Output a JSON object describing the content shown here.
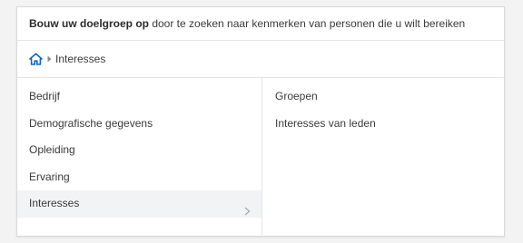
{
  "header": {
    "bold_text": "Bouw uw doelgroep op",
    "rest_text": " door te zoeken naar kenmerken van personen die u wilt bereiken"
  },
  "breadcrumb": {
    "home_icon": "home-icon",
    "separator_icon": "caret-right-icon",
    "current": "Interesses"
  },
  "left_menu": {
    "items": [
      {
        "label": "Bedrijf"
      },
      {
        "label": "Demografische gegevens"
      },
      {
        "label": "Opleiding"
      },
      {
        "label": "Ervaring"
      },
      {
        "label": "Interesses",
        "selected": true
      }
    ]
  },
  "right_menu": {
    "items": [
      {
        "label": "Groepen"
      },
      {
        "label": "Interesses van leden"
      }
    ]
  },
  "colors": {
    "accent": "#0a66c2",
    "selected_bg": "#f1f3f5",
    "border": "#e4e4e4"
  }
}
